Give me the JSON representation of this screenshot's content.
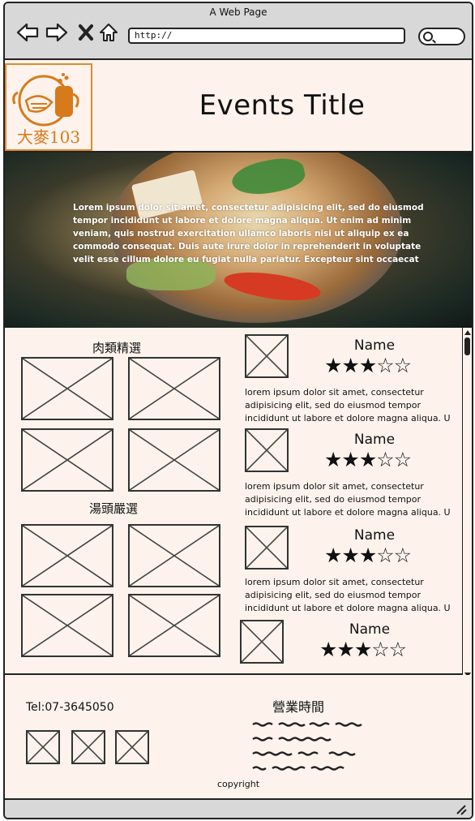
{
  "window": {
    "title": "A Web Page"
  },
  "toolbar": {
    "url": "http://",
    "back_icon": "arrow-left-icon",
    "forward_icon": "arrow-right-icon",
    "stop_icon": "close-icon",
    "home_icon": "home-icon",
    "search_icon": "search-icon"
  },
  "header": {
    "logo_text": "大麥103",
    "page_title": "Events Title"
  },
  "hero": {
    "text": "Lorem ipsum dolor sit amet, consectetur adipisicing elit, sed do eiusmod tempor incididunt ut labore et dolore magna aliqua. Ut enim ad minim veniam, quis nostrud exercitation ullamco laboris nisi ut aliquip ex ea commodo consequat. Duis aute irure dolor in reprehenderit in voluptate velit esse cillum dolore eu fugiat nulla pariatur. Excepteur sint occaecat"
  },
  "menu": {
    "section1_title": "肉類精選",
    "section2_title": "湯頭嚴選"
  },
  "reviews": [
    {
      "name": "Name",
      "stars": "★★★☆☆",
      "text1": "lorem ipsum dolor sit amet, consectetur",
      "text2": "adipisicing elit, sed do eiusmod tempor",
      "text3": "incididunt ut labore et dolore magna aliqua. U"
    },
    {
      "name": "Name",
      "stars": "★★★☆☆",
      "text1": "lorem ipsum dolor sit amet, consectetur",
      "text2": "adipisicing elit, sed do eiusmod tempor",
      "text3": "incididunt ut labore et dolore magna aliqua. U"
    },
    {
      "name": "Name",
      "stars": "★★★☆☆",
      "text1": "lorem ipsum dolor sit amet, consectetur",
      "text2": "adipisicing elit, sed do eiusmod tempor",
      "text3": "incididunt ut labore et dolore magna aliqua. U"
    },
    {
      "name": "Name",
      "stars": "★★★☆☆"
    }
  ],
  "footer": {
    "tel": "Tel:07-3645050",
    "hours_label": "營業時間",
    "copyright": "copyright"
  }
}
